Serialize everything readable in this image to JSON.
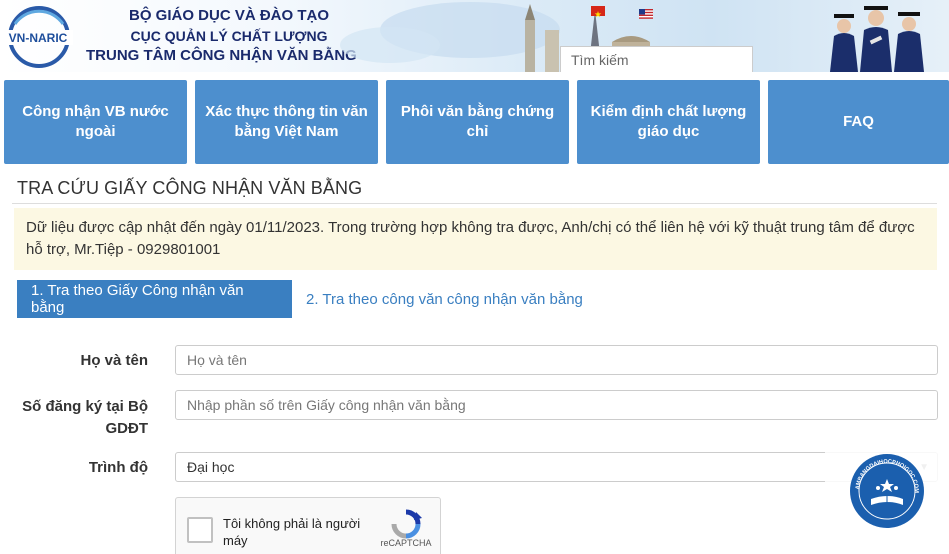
{
  "header": {
    "logo_text": "VN-NARIC",
    "org_line1": "BỘ GIÁO DỤC VÀ ĐÀO TẠO",
    "org_line2": "CỤC QUẢN LÝ CHẤT LƯỢNG",
    "org_line3": "TRUNG TÂM CÔNG NHẬN VĂN BẰNG",
    "search_placeholder": "Tìm kiếm",
    "flags": [
      "vietnam-flag-icon",
      "us-flag-icon"
    ]
  },
  "nav": {
    "items": [
      {
        "label": "Công nhận VB nước ngoài"
      },
      {
        "label": "Xác thực thông tin văn bằng Việt Nam"
      },
      {
        "label": "Phôi văn bằng chứng chỉ"
      },
      {
        "label": "Kiểm định chất lượng giáo dục"
      },
      {
        "label": "FAQ"
      }
    ]
  },
  "main": {
    "title": "TRA CỨU GIẤY CÔNG NHẬN VĂN BẰNG",
    "notice": "Dữ liệu được cập nhật đến ngày 01/11/2023. Trong trường hợp không tra được, Anh/chị có thể liên hệ với kỹ thuật trung tâm để được hỗ trợ, Mr.Tiệp - 0929801001",
    "tabs": [
      {
        "label": "1. Tra theo Giấy Công nhận văn bằng",
        "active": true
      },
      {
        "label": "2. Tra theo công văn công nhận văn bằng",
        "active": false
      }
    ],
    "form": {
      "name_label": "Họ và tên",
      "name_placeholder": "Họ và tên",
      "reg_label_1": "Số đăng ký tại Bộ",
      "reg_label_2": "GDĐT",
      "reg_placeholder": "Nhập phần số trên Giấy công nhận văn bằng",
      "level_label": "Trình độ",
      "level_value": "Đại học"
    },
    "captcha": {
      "text": "Tôi không phải là người máy",
      "brand": "reCAPTCHA"
    }
  },
  "watermark": {
    "text": "LAMBANGDAIHOCPHOIGOC.COM"
  },
  "colors": {
    "nav_bg": "#4d8fce",
    "tab_active": "#3a7fc1",
    "notice_bg": "#fcf8e3",
    "org_text": "#1a2a6c"
  }
}
